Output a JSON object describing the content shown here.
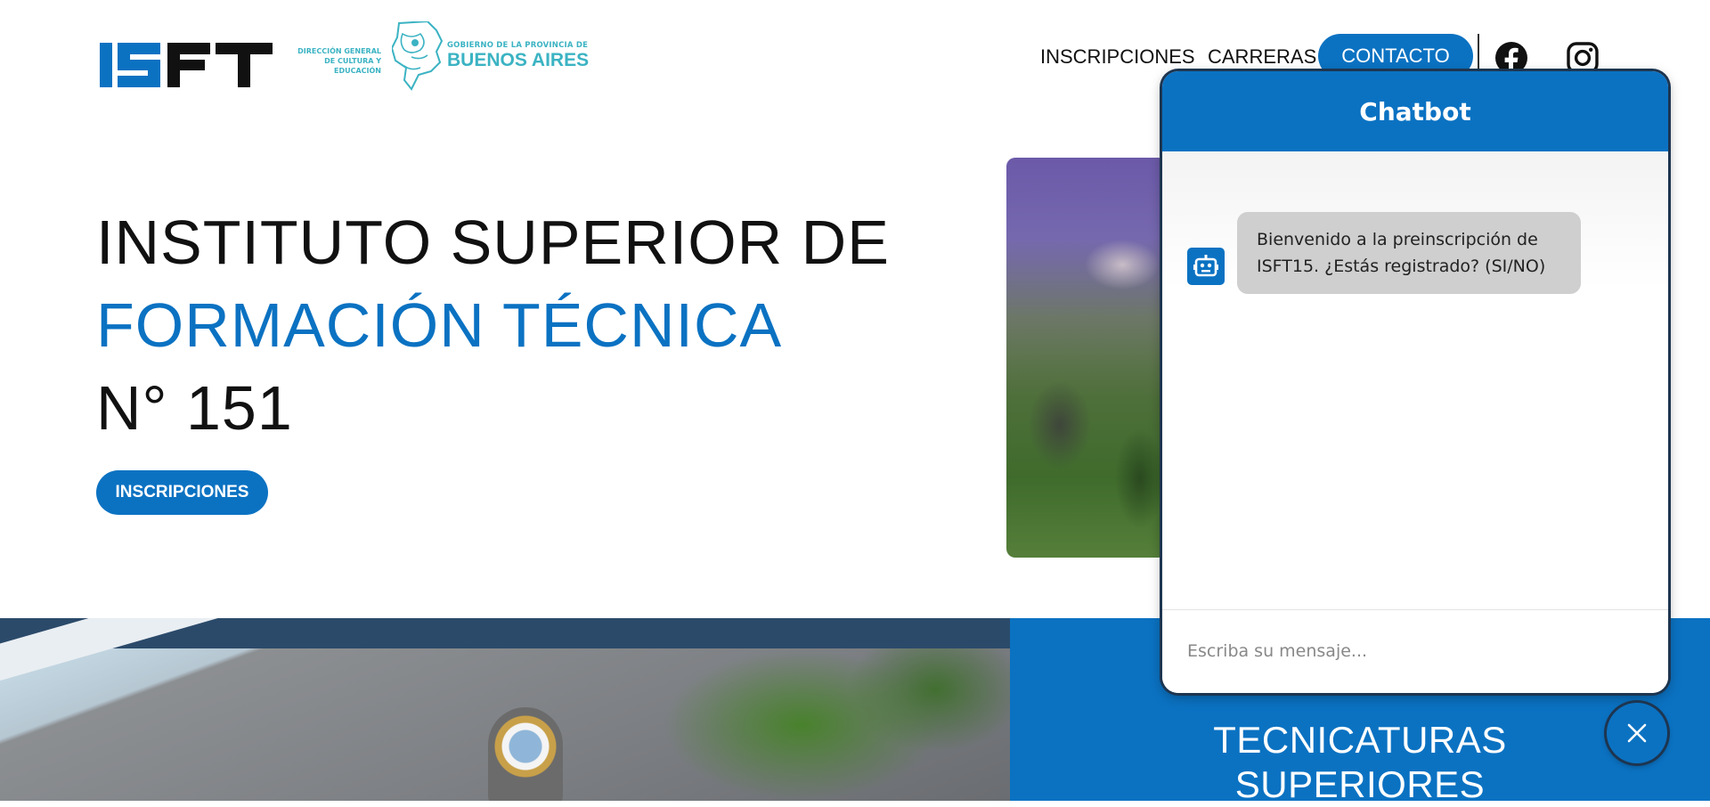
{
  "header": {
    "logo_isft": "ISFT",
    "logo_dgce_lines": [
      "DIRECCIÓN GENERAL",
      "DE CULTURA Y EDUCACIÓN"
    ],
    "logo_pba_small": "GOBIERNO DE LA PROVINCIA DE",
    "logo_pba_big": "BUENOS AIRES",
    "nav": {
      "inscripciones": "INSCRIPCIONES",
      "carreras": "CARRERAS",
      "contacto": "CONTACTO"
    },
    "social_icons": [
      "facebook-icon",
      "instagram-icon"
    ]
  },
  "hero": {
    "line1": "INSTITUTO SUPERIOR DE",
    "line2": "FORMACIÓN TÉCNICA",
    "line3": "N° 151",
    "button": "INSCRIPCIONES"
  },
  "section": {
    "title_line1": "TECNICATURAS",
    "title_line2": "SUPERIORES"
  },
  "chatbot": {
    "title": "Chatbot",
    "messages": [
      {
        "from": "bot",
        "text": "Bienvenido a la preinscripción de ISFT15. ¿Estás registrado? (SI/NO)"
      }
    ],
    "input_placeholder": "Escriba su mensaje...",
    "input_value": ""
  },
  "colors": {
    "brand_blue": "#0b72c2",
    "logo_teal": "#3bb3c3",
    "bubble_gray": "#cfcfcf"
  }
}
